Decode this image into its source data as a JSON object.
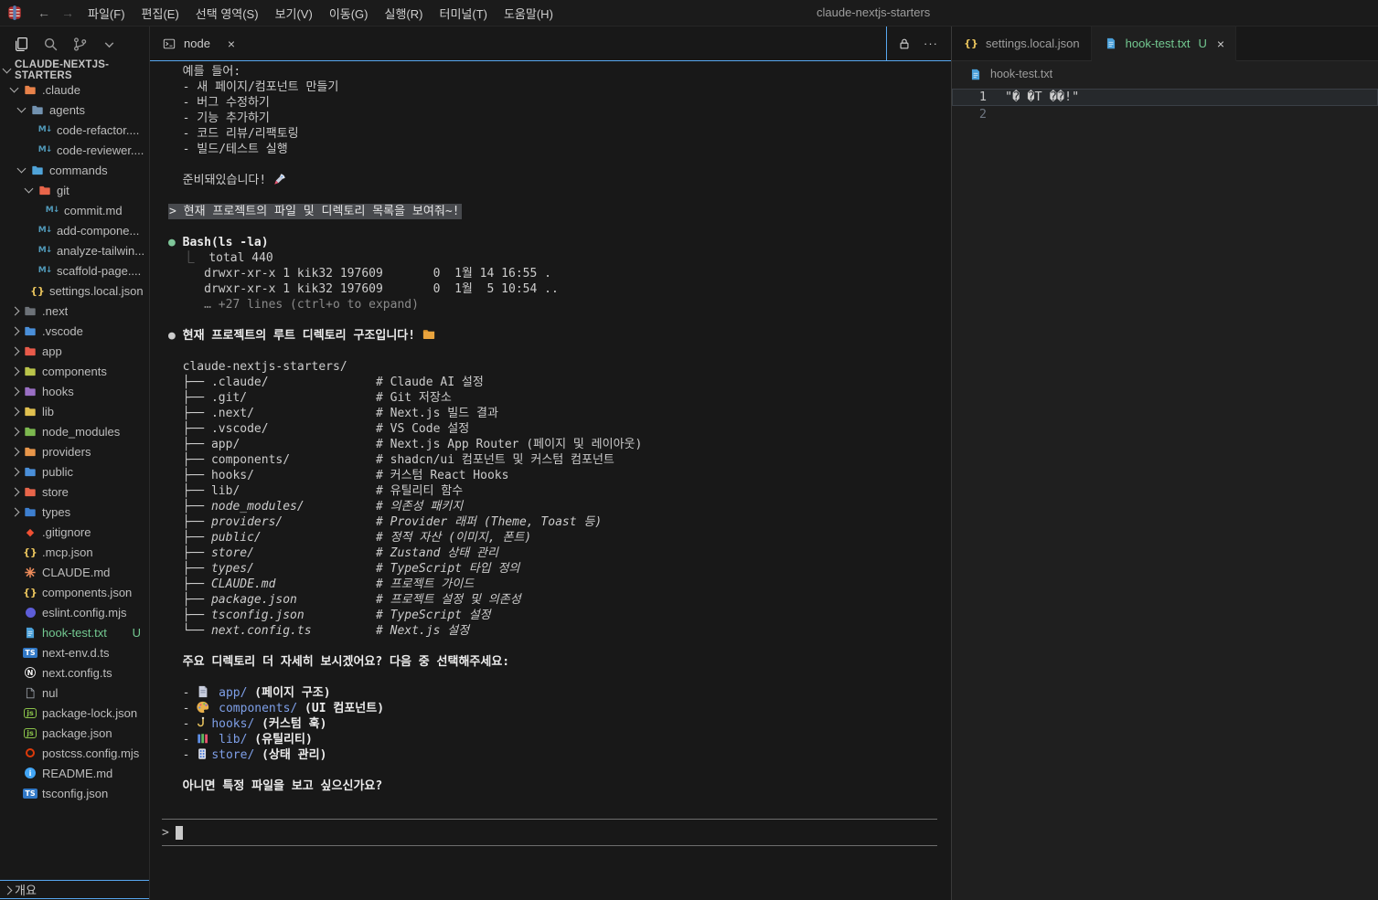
{
  "titlebar": {
    "title": "claude-nextjs-starters",
    "back_arrow": "←",
    "forward_arrow": "→",
    "menus": [
      "파일(F)",
      "편집(E)",
      "선택 영역(S)",
      "보기(V)",
      "이동(G)",
      "실행(R)",
      "터미널(T)",
      "도움말(H)"
    ]
  },
  "sidebar": {
    "toolbar_icons": [
      "files",
      "search",
      "source-control",
      "more"
    ],
    "explorer_title": "CLAUDE-NEXTJS-STARTERS",
    "outline_label": "개요",
    "items": [
      {
        "label": ".claude",
        "indent": 1,
        "chev": "d",
        "icon": "folder",
        "color": "#e8824a"
      },
      {
        "label": "agents",
        "indent": 2,
        "chev": "d",
        "icon": "folder",
        "color": "#7292b0"
      },
      {
        "label": "code-refactor....",
        "indent": 3,
        "icon": "md"
      },
      {
        "label": "code-reviewer....",
        "indent": 3,
        "icon": "md"
      },
      {
        "label": "commands",
        "indent": 2,
        "chev": "d",
        "icon": "folder",
        "color": "#4fa3d8"
      },
      {
        "label": "git",
        "indent": 3,
        "chev": "d",
        "icon": "folder",
        "color": "#e8654a"
      },
      {
        "label": "commit.md",
        "indent": 4,
        "icon": "md"
      },
      {
        "label": "add-compone...",
        "indent": 3,
        "icon": "md"
      },
      {
        "label": "analyze-tailwin...",
        "indent": 3,
        "icon": "md"
      },
      {
        "label": "scaffold-page....",
        "indent": 3,
        "icon": "md"
      },
      {
        "label": "settings.local.json",
        "indent": 2,
        "icon": "braces"
      },
      {
        "label": ".next",
        "indent": 1,
        "chev": "r",
        "icon": "folder",
        "color": "#6d7278"
      },
      {
        "label": ".vscode",
        "indent": 1,
        "chev": "r",
        "icon": "folder",
        "color": "#4a8fd9"
      },
      {
        "label": "app",
        "indent": 1,
        "chev": "r",
        "icon": "folder",
        "color": "#e85a4a"
      },
      {
        "label": "components",
        "indent": 1,
        "chev": "r",
        "icon": "folder",
        "color": "#b9c44a"
      },
      {
        "label": "hooks",
        "indent": 1,
        "chev": "r",
        "icon": "folder",
        "color": "#9a6fc4"
      },
      {
        "label": "lib",
        "indent": 1,
        "chev": "r",
        "icon": "folder",
        "color": "#e0c04f"
      },
      {
        "label": "node_modules",
        "indent": 1,
        "chev": "r",
        "icon": "folder",
        "color": "#7cb84f"
      },
      {
        "label": "providers",
        "indent": 1,
        "chev": "r",
        "icon": "folder",
        "color": "#e8964a"
      },
      {
        "label": "public",
        "indent": 1,
        "chev": "r",
        "icon": "folder",
        "color": "#4a8fd9"
      },
      {
        "label": "store",
        "indent": 1,
        "chev": "r",
        "icon": "folder",
        "color": "#e8654a"
      },
      {
        "label": "types",
        "indent": 1,
        "chev": "r",
        "icon": "folder",
        "color": "#3d7fd0"
      },
      {
        "label": ".gitignore",
        "indent": 1,
        "icon": "git"
      },
      {
        "label": ".mcp.json",
        "indent": 1,
        "icon": "braces"
      },
      {
        "label": "CLAUDE.md",
        "indent": 1,
        "icon": "claude"
      },
      {
        "label": "components.json",
        "indent": 1,
        "icon": "braces"
      },
      {
        "label": "eslint.config.mjs",
        "indent": 1,
        "icon": "eslint"
      },
      {
        "label": "hook-test.txt",
        "indent": 1,
        "icon": "txt",
        "labelColor": "#73c991",
        "badge": "U"
      },
      {
        "label": "next-env.d.ts",
        "indent": 1,
        "icon": "ts"
      },
      {
        "label": "next.config.ts",
        "indent": 1,
        "icon": "ncirc"
      },
      {
        "label": "nul",
        "indent": 1,
        "icon": "page"
      },
      {
        "label": "package-lock.json",
        "indent": 1,
        "icon": "npm"
      },
      {
        "label": "package.json",
        "indent": 1,
        "icon": "npm"
      },
      {
        "label": "postcss.config.mjs",
        "indent": 1,
        "icon": "postcss"
      },
      {
        "label": "README.md",
        "indent": 1,
        "icon": "info"
      },
      {
        "label": "tsconfig.json",
        "indent": 1,
        "icon": "tsconf"
      }
    ]
  },
  "terminal": {
    "tab_label": "node",
    "actions": [
      "lock",
      "ellipsis"
    ],
    "input_prompt": ">",
    "lines": [
      [
        {
          "t": "  예를 들어:"
        }
      ],
      [
        {
          "t": "  - 새 페이지/컴포넌트 만들기"
        }
      ],
      [
        {
          "t": "  - 버그 수정하기"
        }
      ],
      [
        {
          "t": "  - 기능 추가하기"
        }
      ],
      [
        {
          "t": "  - 코드 리뷰/리팩토링"
        }
      ],
      [
        {
          "t": "  - 빌드/테스트 실행"
        }
      ],
      [],
      [
        {
          "t": "  준비돼있습니다! "
        },
        {
          "i": "rocket"
        }
      ],
      [],
      [
        {
          "t": "> 현재 프로젝트의 파일 및 디렉토리 목록을 보여줘~!",
          "c": "echo"
        }
      ],
      [],
      [
        {
          "t": "●",
          "c": "green"
        },
        {
          "t": " "
        },
        {
          "t": "Bash(ls -la)",
          "c": "bold"
        }
      ],
      [
        {
          "t": "  ⎿  ",
          "c": "dim"
        },
        {
          "t": "total 440"
        }
      ],
      [
        {
          "t": "     drwxr-xr-x 1 kik32 197609       0  1월 14 16:55 ."
        }
      ],
      [
        {
          "t": "     drwxr-xr-x 1 kik32 197609       0  1월  5 10:54 .."
        }
      ],
      [
        {
          "t": "     … +27 lines (ctrl+o to expand)",
          "c": "dim"
        }
      ],
      [],
      [
        {
          "t": "● "
        },
        {
          "t": "현재 프로젝트의 루트 디렉토리 구조입니다! ",
          "c": "bold"
        },
        {
          "i": "folder"
        }
      ],
      [],
      [
        {
          "t": "  claude-nextjs-starters/"
        }
      ],
      [
        {
          "t": "  ├── .claude/               # Claude AI 설정"
        }
      ],
      [
        {
          "t": "  ├── .git/                  # Git 저장소"
        }
      ],
      [
        {
          "t": "  ├── .next/                 # Next.js 빌드 결과"
        }
      ],
      [
        {
          "t": "  ├── .vscode/               # VS Code 설정"
        }
      ],
      [
        {
          "t": "  ├── app/                   # Next.js App Router (페이지 및 레이아웃)"
        }
      ],
      [
        {
          "t": "  ├── components/            # shadcn/ui 컴포넌트 및 커스텀 컴포넌트"
        }
      ],
      [
        {
          "t": "  ├── hooks/                 # 커스텀 React Hooks"
        }
      ],
      [
        {
          "t": "  ├── lib/                   # 유틸리티 함수"
        }
      ],
      [
        {
          "t": "  ├── node_modules/          # 의존성 패키지",
          "c": "italic"
        }
      ],
      [
        {
          "t": "  ├── providers/             # Provider 래퍼 (Theme, Toast 등)",
          "c": "italic"
        }
      ],
      [
        {
          "t": "  ├── public/                # 정적 자산 (이미지, 폰트)",
          "c": "italic"
        }
      ],
      [
        {
          "t": "  ├── store/                 # Zustand 상태 관리",
          "c": "italic"
        }
      ],
      [
        {
          "t": "  ├── types/                 # TypeScript 타입 정의",
          "c": "italic"
        }
      ],
      [
        {
          "t": "  ├── CLAUDE.md              # 프로젝트 가이드",
          "c": "italic"
        }
      ],
      [
        {
          "t": "  ├── package.json           # 프로젝트 설정 및 의존성",
          "c": "italic"
        }
      ],
      [
        {
          "t": "  ├── tsconfig.json          # TypeScript 설정",
          "c": "italic"
        }
      ],
      [
        {
          "t": "  └── next.config.ts         # Next.js 설정",
          "c": "italic"
        }
      ],
      [],
      [
        {
          "t": "  주요 디렉토리 더 자세히 보시겠어요? 다음 중 선택해주세요:",
          "c": "bold"
        }
      ],
      [],
      [
        {
          "t": "  - "
        },
        {
          "i": "page"
        },
        {
          "t": " "
        },
        {
          "t": "app/",
          "c": "blue"
        },
        {
          "t": " (페이지 구조)",
          "c": "bold"
        }
      ],
      [
        {
          "t": "  - "
        },
        {
          "i": "palette"
        },
        {
          "t": " "
        },
        {
          "t": "components/",
          "c": "blue"
        },
        {
          "t": " (UI 컴포넌트)",
          "c": "bold"
        }
      ],
      [
        {
          "t": "  - "
        },
        {
          "i": "hook"
        },
        {
          "t": "hooks/",
          "c": "blue"
        },
        {
          "t": " (커스텀 훅)",
          "c": "bold"
        }
      ],
      [
        {
          "t": "  - "
        },
        {
          "i": "books"
        },
        {
          "t": " "
        },
        {
          "t": "lib/",
          "c": "blue"
        },
        {
          "t": " (유틸리티)",
          "c": "bold"
        }
      ],
      [
        {
          "t": "  - "
        },
        {
          "i": "dots"
        },
        {
          "t": "store/",
          "c": "blue"
        },
        {
          "t": " (상태 관리)",
          "c": "bold"
        }
      ],
      [],
      [
        {
          "t": "  아니면 특정 파일을 보고 싶으신가요?",
          "c": "bold"
        }
      ]
    ]
  },
  "editor": {
    "tabs": [
      {
        "label": "settings.local.json",
        "icon": "braces",
        "active": false
      },
      {
        "label": "hook-test.txt",
        "icon": "txt",
        "badge": "U",
        "close": "×",
        "active": true
      }
    ],
    "breadcrumb": {
      "icon": "txt",
      "label": "hook-test.txt"
    },
    "lines": [
      {
        "num": "1",
        "text": "\"� �T ��!\"",
        "current": true
      },
      {
        "num": "2",
        "text": ""
      }
    ]
  },
  "colors": {
    "accent": "#58a8f0",
    "untracked_green": "#73c991",
    "path_blue": "#7e9fe8",
    "echo_bg": "#47494d"
  }
}
